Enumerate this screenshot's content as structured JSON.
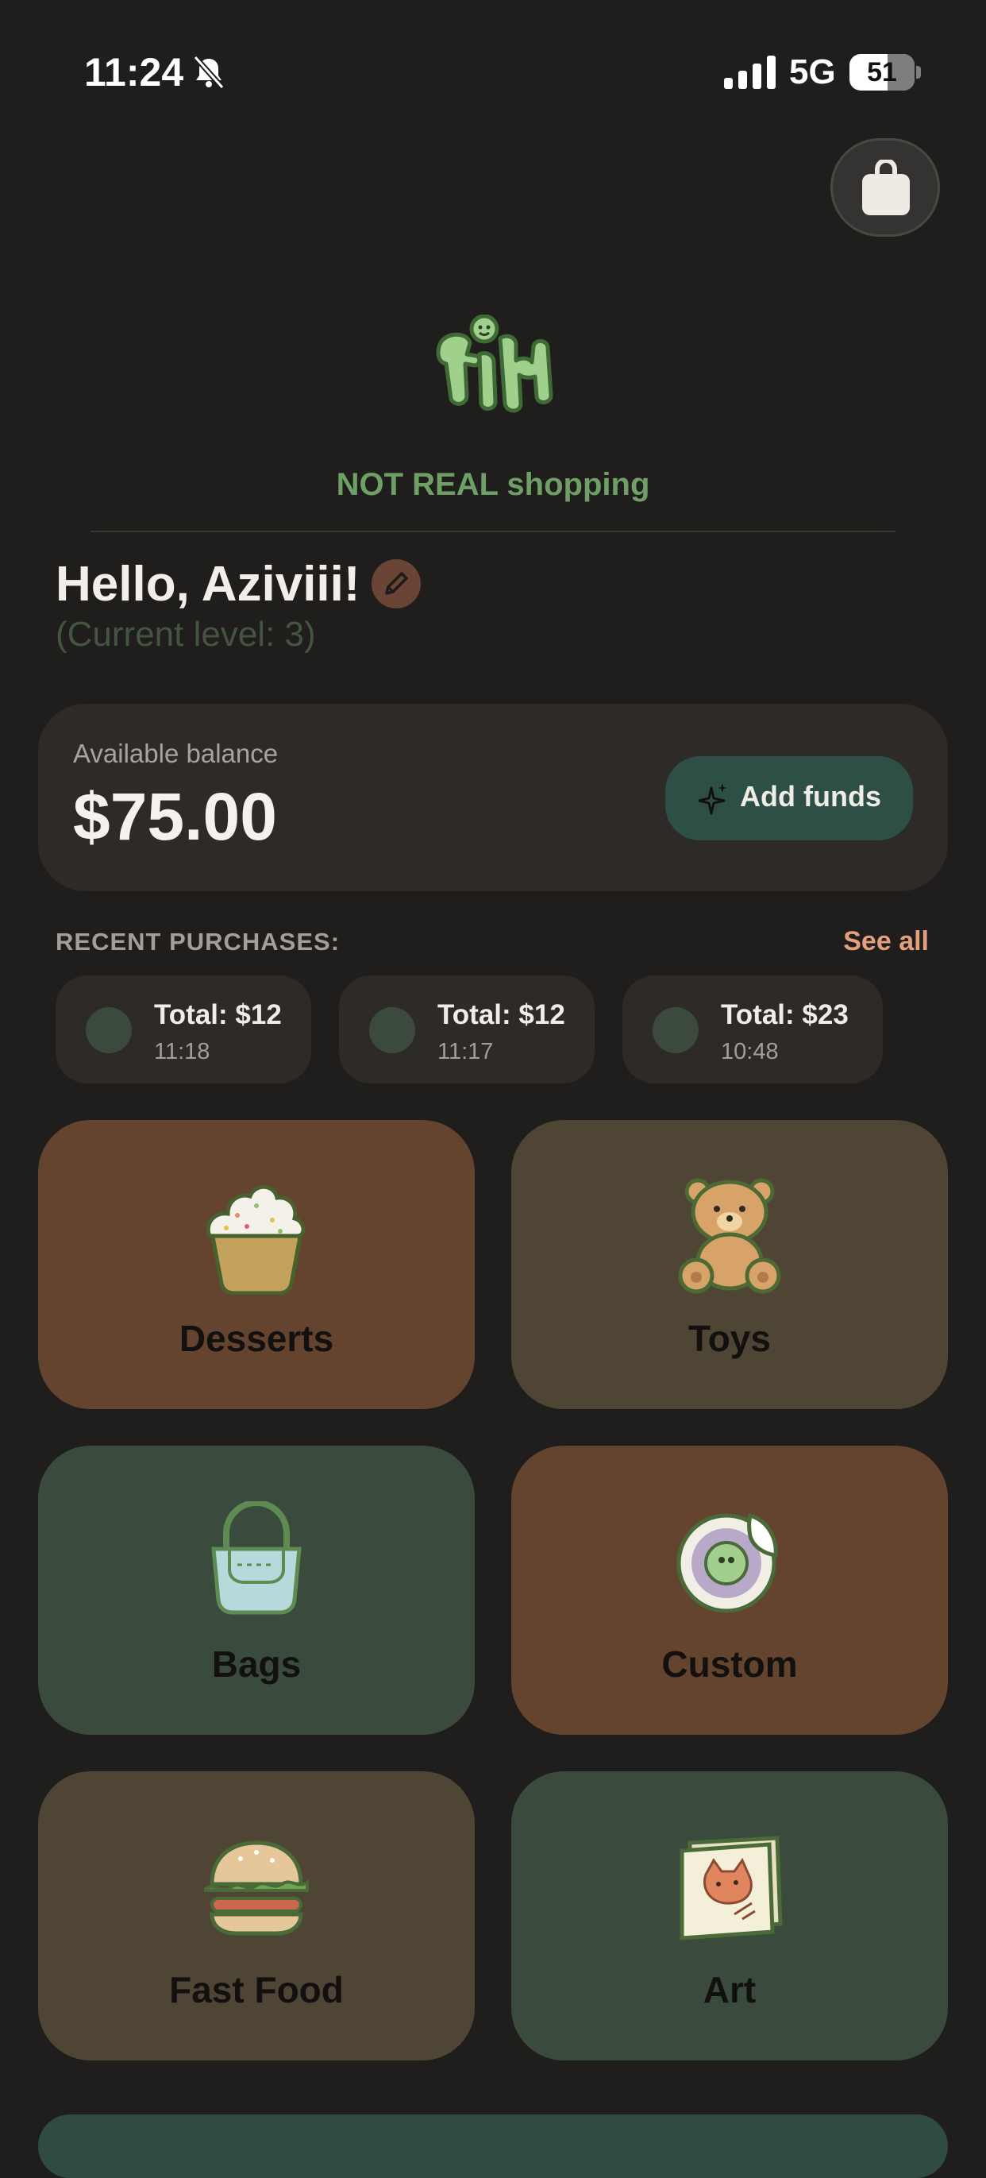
{
  "status_bar": {
    "time": "11:24",
    "network": "5G",
    "battery": "51",
    "icons": [
      "bell-slash-icon",
      "signal-icon"
    ]
  },
  "header": {
    "bag_icon": "shopping-bag-icon",
    "tagline": "NOT REAL shopping"
  },
  "greeting": {
    "hello": "Hello, Aziviii!",
    "level": "(Current level: 3)",
    "edit_icon": "pencil-icon"
  },
  "balance": {
    "label": "Available balance",
    "amount": "$75.00",
    "add_funds_label": "Add funds",
    "add_funds_icon": "sparkle-icon"
  },
  "recent": {
    "title": "RECENT PURCHASES:",
    "see_all": "See all",
    "items": [
      {
        "total": "Total: $12",
        "time": "11:18"
      },
      {
        "total": "Total: $12",
        "time": "11:17"
      },
      {
        "total": "Total: $23",
        "time": "10:48"
      }
    ]
  },
  "categories": [
    {
      "label": "Desserts",
      "icon": "cupcake-icon",
      "color": "#64432f"
    },
    {
      "label": "Toys",
      "icon": "teddy-bear-icon",
      "color": "#4f4534"
    },
    {
      "label": "Bags",
      "icon": "handbag-icon",
      "color": "#3a4b3d"
    },
    {
      "label": "Custom",
      "icon": "sticker-icon",
      "color": "#64432f"
    },
    {
      "label": "Fast Food",
      "icon": "burger-icon",
      "color": "#4f4534"
    },
    {
      "label": "Art",
      "icon": "art-book-icon",
      "color": "#3a4b3d"
    }
  ],
  "colors": {
    "background": "#1f1e1c",
    "accent_green": "#6f9f66",
    "accent_peach": "#e2a07d",
    "add_funds_bg": "#2e4f45"
  }
}
